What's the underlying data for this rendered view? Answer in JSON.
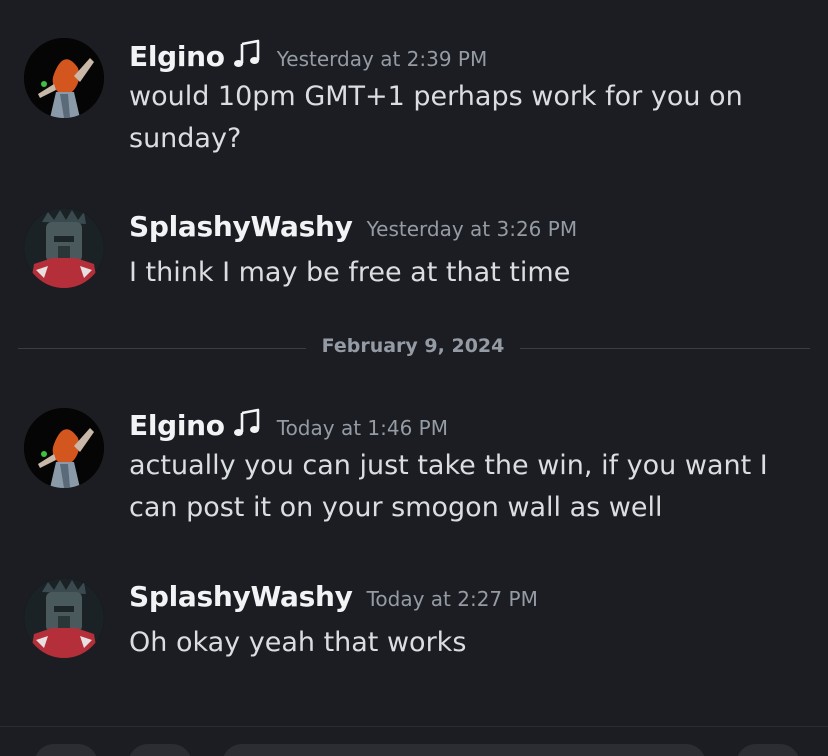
{
  "messages": [
    {
      "author": "Elgino",
      "status_icon": "music-note-icon",
      "timestamp": "Yesterday at 2:39 PM",
      "lines": [
        "would 10pm GMT+1 perhaps work for you on",
        "sunday?"
      ]
    },
    {
      "author": "SplashyWashy",
      "timestamp": "Yesterday at 3:26 PM",
      "lines": [
        "I think I may be free at that time"
      ]
    },
    {
      "author": "Elgino",
      "status_icon": "music-note-icon",
      "timestamp": "Today at 1:46 PM",
      "lines": [
        "actually you can just take the win, if you want I",
        "can post it on your smogon wall as well"
      ]
    },
    {
      "author": "SplashyWashy",
      "timestamp": "Today at 2:27 PM",
      "lines": [
        "Oh okay yeah that works"
      ]
    }
  ],
  "date_divider": "February 9, 2024",
  "colors": {
    "background": "#1c1d22",
    "username": "#f2f3f5",
    "timestamp": "#949ba4",
    "body_text": "#dbdee1",
    "divider": "#3b3d44"
  }
}
